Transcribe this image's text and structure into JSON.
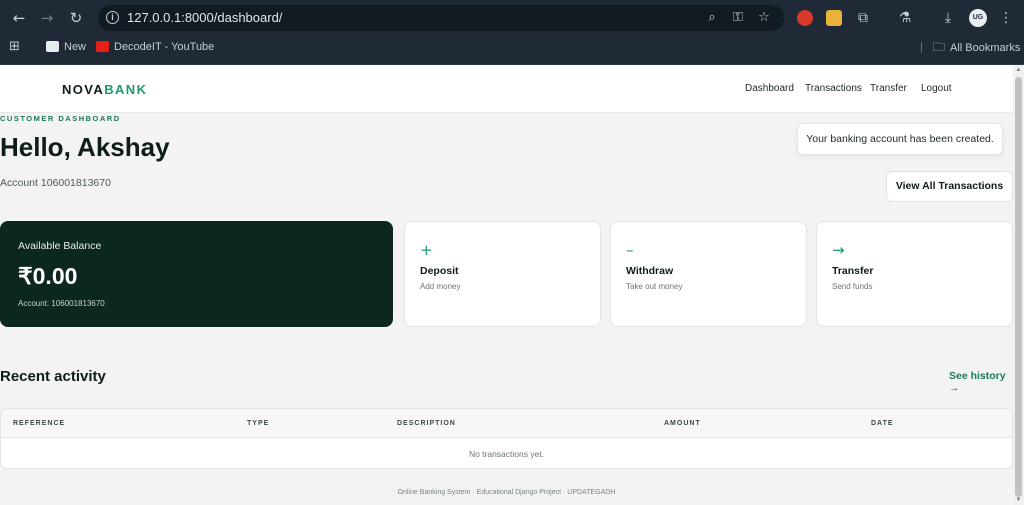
{
  "browser": {
    "url": "127.0.0.1:8000/dashboard/",
    "bookmarks": [
      {
        "label": "New"
      },
      {
        "label": "DecodeIT - YouTube"
      }
    ],
    "all_bookmarks": "All Bookmarks",
    "avatar_text": "UG"
  },
  "header": {
    "logo_a": "NOVA",
    "logo_b": "BANK",
    "nav": [
      {
        "label": "Dashboard"
      },
      {
        "label": "Transactions"
      },
      {
        "label": "Transfer"
      },
      {
        "label": "Logout"
      }
    ]
  },
  "intro": {
    "eyebrow": "CUSTOMER DASHBOARD",
    "greeting": "Hello, Akshay",
    "account": "Account 106001813670"
  },
  "toast": "Your banking account has been created.",
  "view_all": "View All Transactions",
  "balance": {
    "label": "Available Balance",
    "amount": "₹0.00",
    "account": "Account: 106001813670"
  },
  "actions": [
    {
      "icon": "+",
      "title": "Deposit",
      "sub": "Add money"
    },
    {
      "icon": "–",
      "title": "Withdraw",
      "sub": "Take out money"
    },
    {
      "icon": "→",
      "title": "Transfer",
      "sub": "Send funds"
    }
  ],
  "recent": {
    "title": "Recent activity",
    "see_history": "See history →",
    "columns": [
      "REFERENCE",
      "TYPE",
      "DESCRIPTION",
      "AMOUNT",
      "DATE"
    ],
    "empty": "No transactions yet."
  },
  "footer": "Online Banking System · Educational Django Project · UPDATEGADH",
  "colors": {
    "brand_green": "#1c9a6b",
    "dark_card": "#0c2720",
    "chrome": "#1f2a36"
  }
}
